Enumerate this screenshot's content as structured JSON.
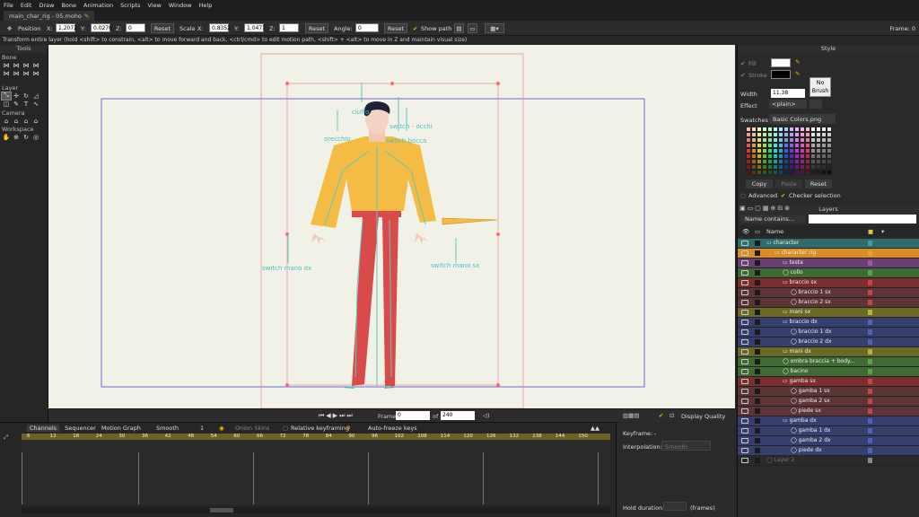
{
  "menu": [
    "File",
    "Edit",
    "Draw",
    "Bone",
    "Animation",
    "Scripts",
    "View",
    "Window",
    "Help"
  ],
  "document_tab": "main_char_rig - 05.moho",
  "toolbar": {
    "position_label": "Position",
    "x_label": "X:",
    "x_value": "1.2072",
    "y_label": "Y:",
    "y_value": "0.0276",
    "z_label": "Z:",
    "z_value": "0",
    "reset1": "Reset",
    "scale_label": "Scale",
    "sx_label": "X:",
    "sx_value": "0.8352",
    "sy_label": "Y:",
    "sy_value": "1.0477",
    "sz_label": "Z:",
    "sz_value": "1",
    "reset2": "Reset",
    "angle_label": "Angle:",
    "angle_value": "0",
    "reset3": "Reset",
    "show_path": "Show path",
    "frame_readout": "Frame: 0"
  },
  "hint": "Transform entire layer (hold <shift> to constrain, <alt> to move forward and back, <ctrl/cmd> to edit motion path, <shift> + <alt> to move in Z and maintain visual size)",
  "tools_panel": {
    "title": "Tools",
    "bone": "Bone",
    "layer": "Layer",
    "camera": "Camera",
    "workspace": "Workspace"
  },
  "canvas_labels": {
    "ciuffo": "ciuffo",
    "occhi": "switch - occhi",
    "orecchio": "orecchio",
    "bocca": "switch bocca",
    "mano_dx": "switch mano dx",
    "mano_sx": "switch mano sx"
  },
  "playbar": {
    "frame_label": "Frame",
    "frame_value": "0",
    "of_label": "of",
    "total": "240",
    "display_quality": "Display Quality"
  },
  "timeline": {
    "tabs": [
      "Channels",
      "Sequencer",
      "Motion Graph"
    ],
    "interp": "Smooth",
    "step": "1",
    "onion": "Onion Skins",
    "relative": "Relative keyframing",
    "autofreeze": "Auto-freeze keys",
    "ticks": [
      "6",
      "12",
      "18",
      "24",
      "30",
      "36",
      "42",
      "48",
      "54",
      "60",
      "66",
      "72",
      "78",
      "84",
      "90",
      "96",
      "102",
      "108",
      "114",
      "120",
      "126",
      "132",
      "138",
      "144",
      "150"
    ]
  },
  "keyframe_panel": {
    "keyframe_label": "Keyframe:",
    "keyframe_value": "-",
    "interp_label": "Interpolation:",
    "interp_value": "Smooth",
    "hold_label": "Hold duration",
    "hold_unit": "(frames)"
  },
  "style": {
    "title": "Style",
    "fill": "Fill",
    "stroke": "Stroke",
    "width_label": "Width",
    "width_value": "11.38",
    "no_brush": "No\nBrush",
    "effect_label": "Effect",
    "effect_value": "<plain>",
    "swatches_label": "Swatches",
    "swatches_value": "Basic Colors.png",
    "copy": "Copy",
    "paste": "Paste",
    "reset": "Reset",
    "advanced": "Advanced",
    "checker": "Checker selection"
  },
  "layers_panel": {
    "title": "Layers",
    "filter_placeholder": "Name contains...",
    "name_header": "Name",
    "rows": [
      {
        "name": "character",
        "bg": "#2f6b6a",
        "sw": "#3a9e9b"
      },
      {
        "name": "character rig",
        "bg": "#d98d22",
        "sw": "#e9a030"
      },
      {
        "name": "testa",
        "bg": "#6a3f73",
        "sw": "#9b59a8"
      },
      {
        "name": "collo",
        "bg": "#3f6a33",
        "sw": "#5ba34a"
      },
      {
        "name": "braccio sx",
        "bg": "#7a2e2e",
        "sw": "#c04848"
      },
      {
        "name": "braccio 1 sx",
        "bg": "#5e3536",
        "sw": "#c04848"
      },
      {
        "name": "braccio 2 sx",
        "bg": "#5e3536",
        "sw": "#c04848"
      },
      {
        "name": "mani sx",
        "bg": "#6b6a25",
        "sw": "#b5b33a"
      },
      {
        "name": "braccio dx",
        "bg": "#363f6e",
        "sw": "#5263b3"
      },
      {
        "name": "braccio 1 dx",
        "bg": "#363f6e",
        "sw": "#5263b3"
      },
      {
        "name": "braccio 2 dx",
        "bg": "#363f6e",
        "sw": "#5263b3"
      },
      {
        "name": "mani dx",
        "bg": "#6b6a25",
        "sw": "#b5b33a"
      },
      {
        "name": "ombra braccia + body...",
        "bg": "#3f6a33",
        "sw": "#5ba34a"
      },
      {
        "name": "bacino",
        "bg": "#3f6a33",
        "sw": "#5ba34a"
      },
      {
        "name": "gamba sx",
        "bg": "#7a2e2e",
        "sw": "#c04848"
      },
      {
        "name": "gamba 1 sx",
        "bg": "#5e3536",
        "sw": "#c04848"
      },
      {
        "name": "gamba 2 sx",
        "bg": "#5e3536",
        "sw": "#c04848"
      },
      {
        "name": "piede sx",
        "bg": "#5e3536",
        "sw": "#c04848"
      },
      {
        "name": "gamba dx",
        "bg": "#363f6e",
        "sw": "#5263b3"
      },
      {
        "name": "gamba 1 dx",
        "bg": "#363f6e",
        "sw": "#5263b3"
      },
      {
        "name": "gamba 2 dx",
        "bg": "#363f6e",
        "sw": "#5263b3"
      },
      {
        "name": "piede dx",
        "bg": "#363f6e",
        "sw": "#5263b3"
      },
      {
        "name": "Layer 2",
        "bg": "#2a2a2a",
        "sw": "#888888"
      }
    ]
  }
}
